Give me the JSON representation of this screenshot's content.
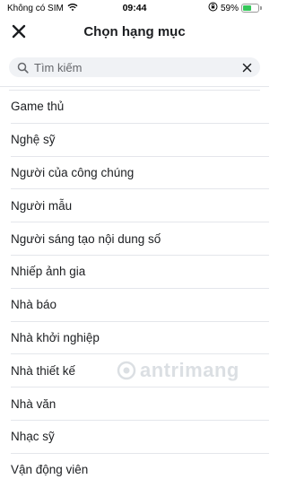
{
  "status_bar": {
    "carrier": "Không có SIM",
    "time": "09:44",
    "battery_percent": "59%",
    "battery_level": 0.59,
    "icons": [
      "wifi-icon",
      "orientation-lock-icon",
      "battery-charging-icon"
    ]
  },
  "header": {
    "title": "Chọn hạng mục",
    "close_icon": "close-icon"
  },
  "search": {
    "placeholder": "Tìm kiếm",
    "value": "",
    "icon": "search-icon",
    "clear_icon": "clear-icon"
  },
  "categories": [
    "Game thủ",
    "Nghệ sỹ",
    "Người của công chúng",
    "Người mẫu",
    "Người sáng tạo nội dung số",
    "Nhiếp ảnh gia",
    "Nhà báo",
    "Nhà khởi nghiệp",
    "Nhà thiết kế",
    "Nhà văn",
    "Nhạc sỹ",
    "Vận động viên"
  ],
  "watermark": {
    "text": "antrimang",
    "icon": "watermark-logo-icon"
  },
  "colors": {
    "divider": "#e4e6eb",
    "search_bg": "#f0f2f5",
    "text_primary": "#1c1e21",
    "text_secondary": "#65676b",
    "battery": "#34c759"
  }
}
